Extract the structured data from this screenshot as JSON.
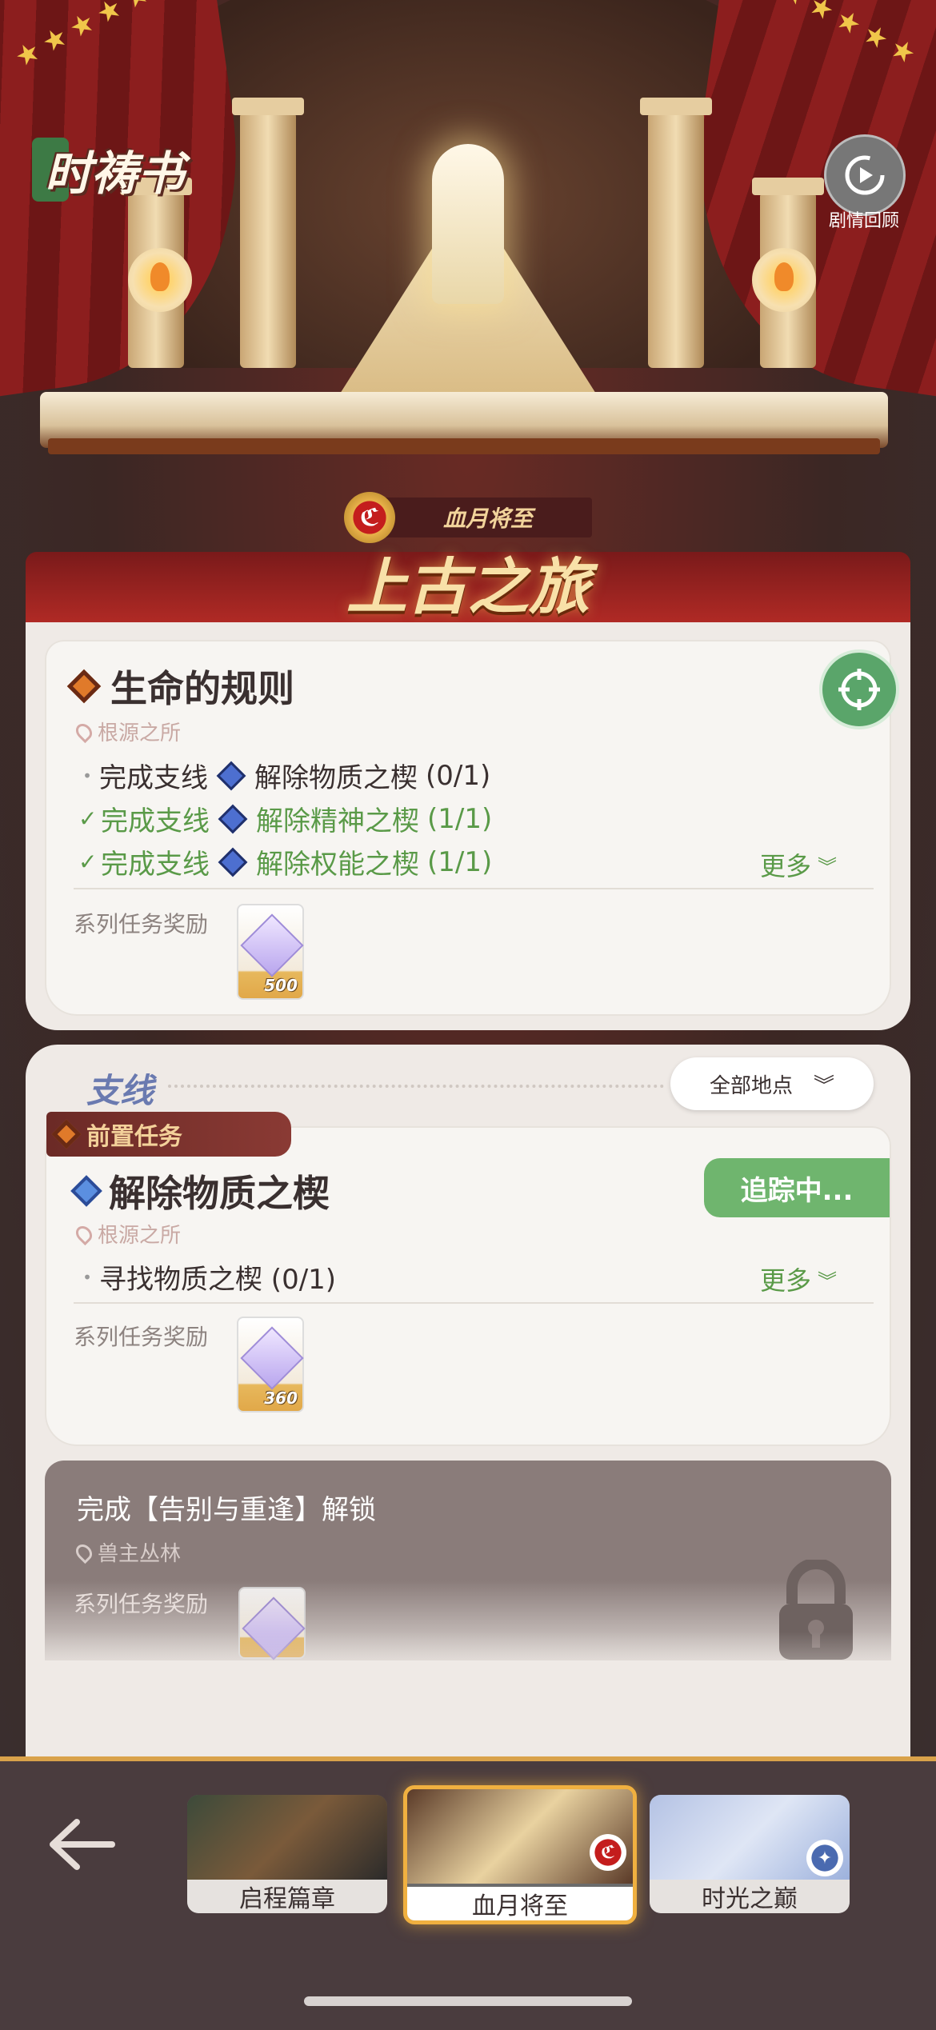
{
  "app": {
    "logo_text": "时祷书",
    "replay_label": "剧情回顾"
  },
  "chapter_banner": {
    "subtitle": "血月将至",
    "title": "上古之旅",
    "emblem": "ℭ"
  },
  "main_quest": {
    "title": "生命的规则",
    "location": "根源之所",
    "tasks": [
      {
        "prefix": "完成支线",
        "name": "解除物质之楔",
        "progress": "(0/1)",
        "done": false
      },
      {
        "prefix": "完成支线",
        "name": "解除精神之楔",
        "progress": "(1/1)",
        "done": true
      },
      {
        "prefix": "完成支线",
        "name": "解除权能之楔",
        "progress": "(1/1)",
        "done": true
      }
    ],
    "more_label": "更多",
    "reward_label": "系列任务奖励",
    "reward_amount": "500"
  },
  "side_quests": {
    "section_title": "支线",
    "filter_label": "全部地点",
    "prerequisite_tag": "前置任务",
    "tracking_label": "追踪中...",
    "quest": {
      "title": "解除物质之楔",
      "location": "根源之所",
      "task": "寻找物质之楔 (0/1)",
      "more_label": "更多",
      "reward_label": "系列任务奖励",
      "reward_amount": "360"
    },
    "locked_quest": {
      "title": "完成【告别与重逢】解锁",
      "location": "兽主丛林",
      "reward_label": "系列任务奖励"
    }
  },
  "chapters": [
    {
      "label": "启程篇章",
      "active": false
    },
    {
      "label": "血月将至",
      "active": true
    },
    {
      "label": "时光之巅",
      "active": false
    }
  ],
  "colors": {
    "accent_green": "#5a9a48",
    "tracking_green": "#6fb56e",
    "banner_red": "#b12a25",
    "gold": "#f0b040"
  }
}
